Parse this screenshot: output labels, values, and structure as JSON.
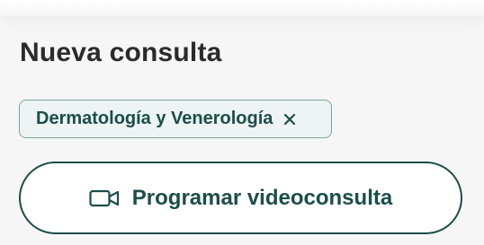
{
  "header": {
    "title": "Nueva consulta"
  },
  "filter_chip": {
    "label": "Dermatología y Venerología",
    "close_icon": "close-icon"
  },
  "action": {
    "label": "Programar videoconsulta",
    "icon": "video-camera-icon"
  },
  "colors": {
    "accent": "#1b4e49",
    "chip_background": "#eef4f3",
    "chip_border": "#7aa5a0",
    "title_text": "#2b2b2b",
    "page_background": "#f6f6f6"
  }
}
